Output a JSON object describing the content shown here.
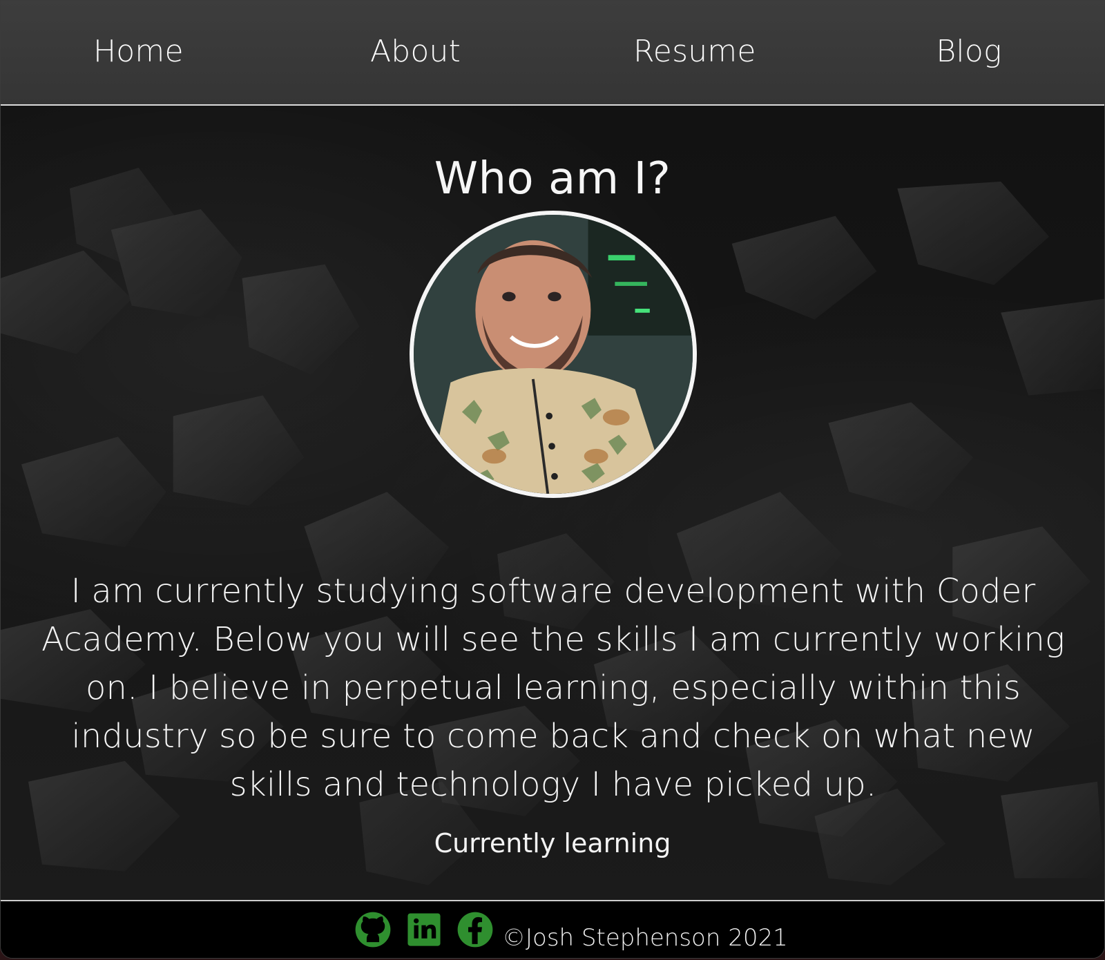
{
  "nav": {
    "items": [
      {
        "label": "Home"
      },
      {
        "label": "About"
      },
      {
        "label": "Resume"
      },
      {
        "label": "Blog"
      }
    ]
  },
  "hero": {
    "heading": "Who am I?",
    "bio": "I am currently studying software development with Coder Academy. Below you will see the skills I am currently working on. I believe in perpetual learning, especially within this industry so be sure to come back and check on what new skills and technology I have picked up.",
    "section_label": "Currently learning"
  },
  "footer": {
    "copyright": "©Josh Stephenson 2021"
  },
  "colors": {
    "nav_bg": "#3a3a3a",
    "footer_bg": "#000000",
    "social_green": "#2e8b2e",
    "text_light": "#f4f4f4"
  },
  "icons": {
    "social": [
      "github-icon",
      "linkedin-icon",
      "facebook-icon"
    ]
  }
}
